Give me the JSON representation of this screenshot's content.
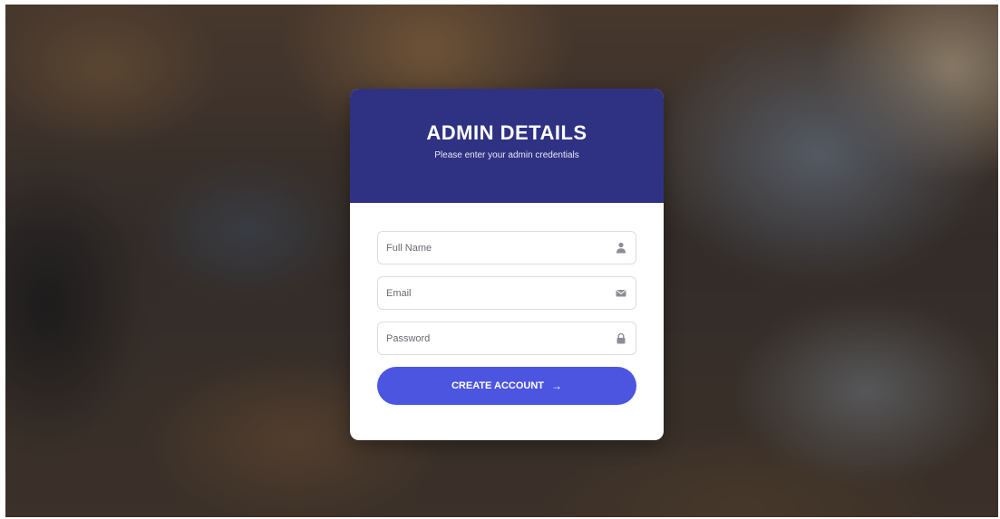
{
  "form": {
    "title": "ADMIN DETAILS",
    "subtitle": "Please enter your admin credentials",
    "fields": [
      {
        "placeholder": "Full Name",
        "value": "",
        "icon": "user-icon"
      },
      {
        "placeholder": "Email",
        "value": "",
        "icon": "envelope-icon"
      },
      {
        "placeholder": "Password",
        "value": "",
        "icon": "lock-icon"
      }
    ],
    "submit_label": "CREATE ACCOUNT",
    "submit_icon": "→"
  },
  "colors": {
    "header": "#2f3283",
    "button": "#4b55e0",
    "card": "#ffffff"
  }
}
